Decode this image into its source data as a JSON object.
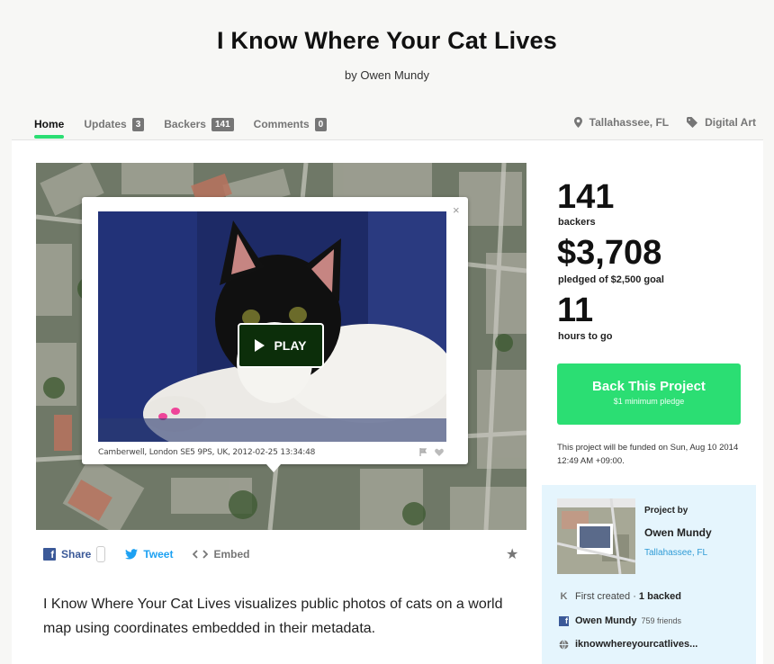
{
  "project": {
    "title": "I Know Where Your Cat Lives",
    "byline": "by Owen Mundy"
  },
  "tabs": [
    {
      "label": "Home",
      "count": null,
      "active": true
    },
    {
      "label": "Updates",
      "count": "3",
      "active": false
    },
    {
      "label": "Backers",
      "count": "141",
      "active": false
    },
    {
      "label": "Comments",
      "count": "0",
      "active": false
    }
  ],
  "meta": {
    "location": "Tallahassee, FL",
    "category": "Digital Art"
  },
  "video": {
    "caption": "Camberwell, London SE5 9PS, UK, 2012-02-25 13:34:48",
    "play_label": "PLAY",
    "close_glyph": "×"
  },
  "share": {
    "facebook_label": "Share",
    "tweet_label": "Tweet",
    "embed_label": "Embed"
  },
  "blurb": "I Know Where Your Cat Lives visualizes public photos of cats on a world map using coordinates embedded in their metadata.",
  "stats": {
    "backers_num": "141",
    "backers_label": "backers",
    "pledged_num": "$3,708",
    "pledged_label": "pledged of $2,500 goal",
    "hours_num": "11",
    "hours_label": "hours to go"
  },
  "cta": {
    "label": "Back This Project",
    "sub": "$1 minimum pledge"
  },
  "funding_note": "This project will be funded on Sun, Aug 10 2014 12:49 AM +09:00.",
  "creator": {
    "project_by": "Project by",
    "name": "Owen Mundy",
    "location": "Tallahassee, FL",
    "history_prefix": "First created",
    "history_sep": " · ",
    "backed": "1 backed",
    "fb_name": "Owen Mundy",
    "fb_friends": "759 friends",
    "website": "iknowwhereyourcatlives..."
  },
  "colors": {
    "accent_green": "#2bde73",
    "facebook_blue": "#3b5998",
    "twitter_blue": "#1da1f2",
    "creator_box_bg": "#e5f5fd"
  }
}
